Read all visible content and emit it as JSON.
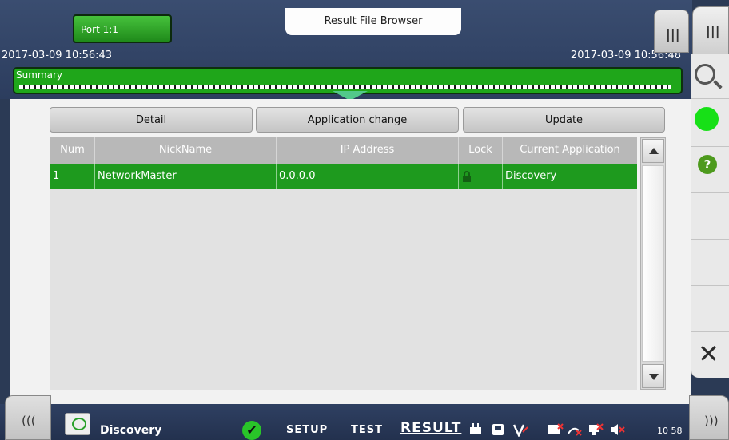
{
  "header": {
    "port_label": "Port 1:1",
    "title": "Result File Browser",
    "timestamp_left": "2017-03-09 10:56:43",
    "timestamp_right": "2017-03-09 10:56:48",
    "summary_label": "Summary"
  },
  "toolbar": {
    "detail_label": "Detail",
    "app_change_label": "Application change",
    "update_label": "Update"
  },
  "table": {
    "columns": [
      "Num",
      "NickName",
      "IP Address",
      "Lock",
      "Current Application"
    ],
    "rows": [
      {
        "num": "1",
        "nickname": "NetworkMaster",
        "ip": "0.0.0.0",
        "lock_icon": "lock-icon",
        "application": "Discovery"
      }
    ]
  },
  "side_panel": {
    "icons": [
      "search-icon",
      "status-indicator-icon",
      "help-icon",
      "close-icon"
    ],
    "help_glyph": "?",
    "close_glyph": "✕",
    "menu_glyph": "|||"
  },
  "bottom_bar": {
    "left_arrows": "(((",
    "right_arrows": ")))",
    "app_name": "Discovery",
    "nav": {
      "setup": "SETUP",
      "test": "TEST",
      "result": "RESULT"
    },
    "clock": "10 58"
  },
  "colors": {
    "accent_green": "#1e9a1e",
    "header_bg": "#2c3d5e",
    "table_header": "#b8b8b8"
  }
}
